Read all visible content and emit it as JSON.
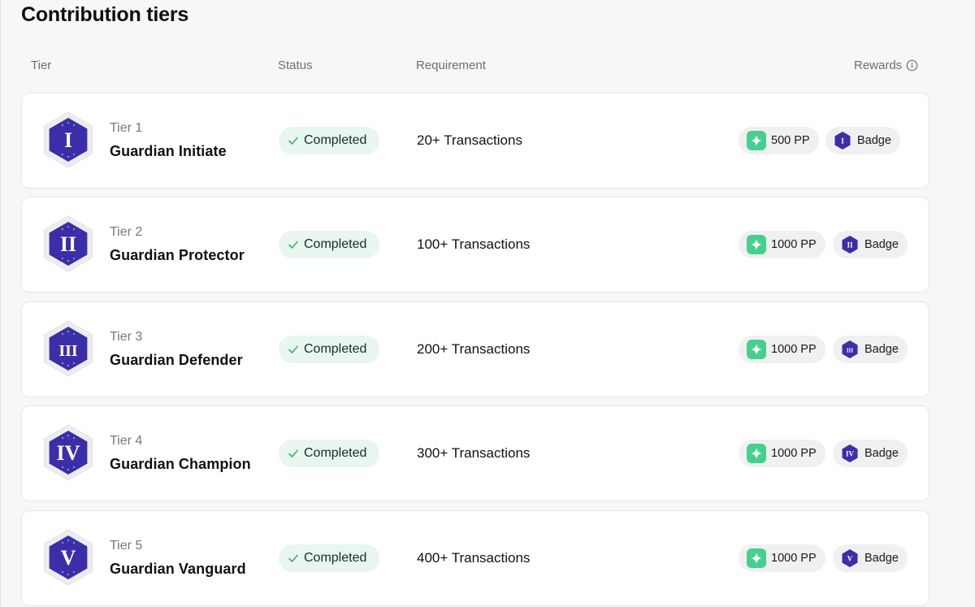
{
  "page": {
    "title": "Contribution tiers"
  },
  "columns": {
    "tier": "Tier",
    "status": "Status",
    "requirement": "Requirement",
    "rewards": "Rewards"
  },
  "colors": {
    "hex_purple": "#3a2fa8",
    "pp_green": "#45d08e",
    "completed_bg": "#e9f5ef"
  },
  "tiers": [
    {
      "numeral": "I",
      "tier_label": "Tier 1",
      "name": "Guardian Initiate",
      "status": "Completed",
      "requirement": "20+ Transactions",
      "pp": "500 PP",
      "badge": "Badge"
    },
    {
      "numeral": "II",
      "tier_label": "Tier 2",
      "name": "Guardian Protector",
      "status": "Completed",
      "requirement": "100+ Transactions",
      "pp": "1000 PP",
      "badge": "Badge"
    },
    {
      "numeral": "III",
      "tier_label": "Tier 3",
      "name": "Guardian Defender",
      "status": "Completed",
      "requirement": "200+ Transactions",
      "pp": "1000 PP",
      "badge": "Badge"
    },
    {
      "numeral": "IV",
      "tier_label": "Tier 4",
      "name": "Guardian Champion",
      "status": "Completed",
      "requirement": "300+ Transactions",
      "pp": "1000 PP",
      "badge": "Badge"
    },
    {
      "numeral": "V",
      "tier_label": "Tier 5",
      "name": "Guardian Vanguard",
      "status": "Completed",
      "requirement": "400+ Transactions",
      "pp": "1000 PP",
      "badge": "Badge"
    }
  ]
}
